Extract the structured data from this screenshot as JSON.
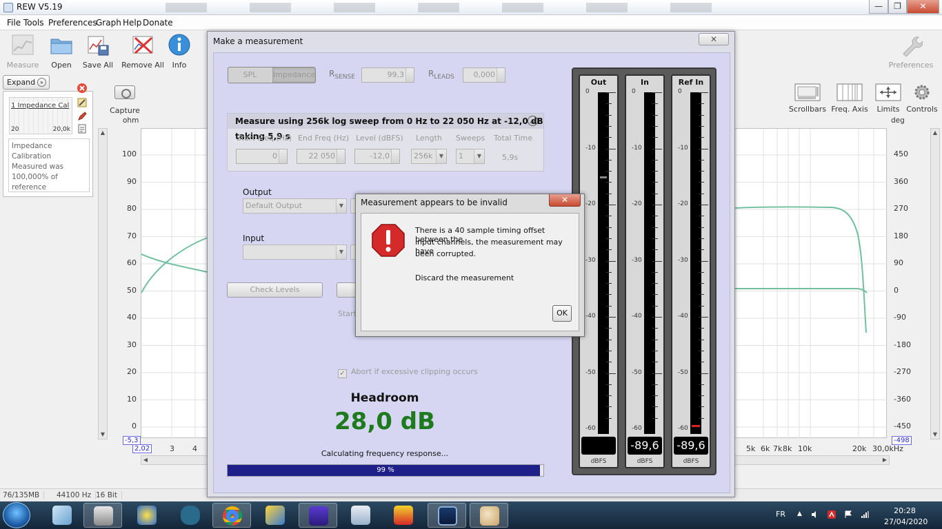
{
  "window": {
    "title": "REW V5.19",
    "min_label": "—",
    "max_label": "❐",
    "close_label": "✕"
  },
  "menu": [
    "File",
    "Tools",
    "Preferences",
    "Graph",
    "Help",
    "Donate"
  ],
  "toolbar": {
    "measure": "Measure",
    "open": "Open",
    "save_all": "Save All",
    "remove_all": "Remove All",
    "info": "Info",
    "preferences": "Preferences"
  },
  "right_toolbar": {
    "scrollbars": "Scrollbars",
    "freq_axis": "Freq. Axis",
    "limits": "Limits",
    "controls": "Controls"
  },
  "side_panel": {
    "expand_label": "Expand",
    "measurement_name": "1 Impedance Cal",
    "thumb_lo": "20",
    "thumb_hi": "20,0k",
    "notes": "Impedance Calibration Measured was 100,000% of reference"
  },
  "capture_label": "Capture",
  "graph": {
    "left_unit": "ohm",
    "right_unit": "deg",
    "left_ticks": [
      "100",
      "90",
      "80",
      "70",
      "60",
      "50",
      "40",
      "30",
      "20",
      "10",
      "0"
    ],
    "right_ticks": [
      "450",
      "360",
      "270",
      "180",
      "90",
      "0",
      "-90",
      "-180",
      "-270",
      "-360",
      "-450"
    ],
    "x_ticks_left": [
      "3",
      "4"
    ],
    "x_ticks_right": [
      "5k",
      "6k",
      "7k",
      "8k",
      "10k",
      "20k",
      "30,0kHz"
    ],
    "y_min_box": "-5,3",
    "x_min_box": "2,02",
    "y_right_min_box": "-498"
  },
  "status": {
    "memory": "76/135MB",
    "sample_rate": "44100 Hz",
    "bit_depth": "16 Bit"
  },
  "measure_dialog": {
    "title": "Make a measurement",
    "close_label": "✕",
    "mode_spl": "SPL",
    "mode_impedance": "Impedance",
    "r_sense_value": "99,3",
    "r_leads_value": "0,000",
    "sweep_summary": "Measure using 256k log sweep from 0 Hz to 22 050 Hz at -12,0 dB taking 5,9 s",
    "col_start_freq": "Start Freq (Hz)",
    "col_end_freq": "End Freq (Hz)",
    "col_level": "Level (dBFS)",
    "col_length": "Length",
    "col_sweeps": "Sweeps",
    "col_total_time": "Total Time",
    "start_freq": "0",
    "end_freq": "22 050",
    "level": "-12,0",
    "length": "256k",
    "sweeps": "1",
    "total_time": "5,9s",
    "output_label": "Output",
    "output_device": "Default Output",
    "input_label": "Input",
    "check_levels": "Check Levels",
    "start_partial": "Start",
    "abort_label": "Abort if excessive clipping occurs",
    "headroom_label": "Headroom",
    "headroom_value": "28,0 dB",
    "calc_status": "Calculating frequency response...",
    "progress_pct": 99,
    "progress_label": "99 %"
  },
  "meters": {
    "out_label": "Out",
    "in_label": "In",
    "ref_label": "Ref In",
    "ticks": [
      "0",
      "-10",
      "-20",
      "-30",
      "-40",
      "-50",
      "-60"
    ],
    "in_peak": "-89,6",
    "ref_peak": "-89,6",
    "unit": "dBFS"
  },
  "alert": {
    "title": "Measurement appears to be invalid",
    "line1": "There is a 40 sample timing offset between the",
    "line2": "input channels, the measurement may have",
    "line3": "been corrupted.",
    "line4": "Discard the measurement",
    "ok": "OK"
  },
  "taskbar": {
    "lang": "FR",
    "time": "20:28",
    "date": "27/04/2020"
  },
  "colors": {
    "trace": "#6fbf9f",
    "headroom": "#1d7a1d",
    "progress": "#1f1f8a"
  }
}
